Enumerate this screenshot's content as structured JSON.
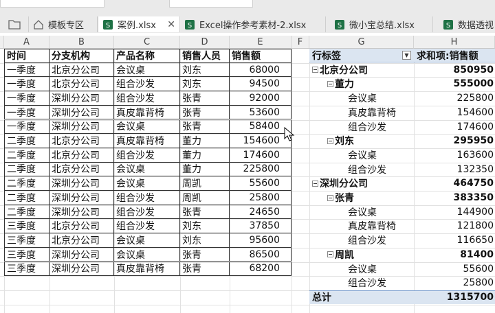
{
  "tabs": [
    {
      "label": "模板专区"
    },
    {
      "label": "案例.xlsx"
    },
    {
      "label": "Excel操作参考素材-2.xlsx"
    },
    {
      "label": "微小宝总结.xlsx"
    },
    {
      "label": "数据透视"
    }
  ],
  "columns": [
    "A",
    "B",
    "C",
    "D",
    "E",
    "F",
    "G",
    "H"
  ],
  "table": {
    "headers": [
      "时间",
      "分支机构",
      "产品名称",
      "销售人员",
      "销售额"
    ],
    "rows": [
      [
        "一季度",
        "北京分公司",
        "会议桌",
        "刘东",
        "68000"
      ],
      [
        "一季度",
        "北京分公司",
        "组合沙发",
        "刘东",
        "94500"
      ],
      [
        "一季度",
        "深圳分公司",
        "组合沙发",
        "张青",
        "92000"
      ],
      [
        "一季度",
        "深圳分公司",
        "真皮靠背椅",
        "张青",
        "53600"
      ],
      [
        "一季度",
        "深圳分公司",
        "会议桌",
        "张青",
        "58400"
      ],
      [
        "二季度",
        "北京分公司",
        "真皮靠背椅",
        "董力",
        "154600"
      ],
      [
        "二季度",
        "北京分公司",
        "组合沙发",
        "董力",
        "174600"
      ],
      [
        "二季度",
        "北京分公司",
        "会议桌",
        "董力",
        "225800"
      ],
      [
        "二季度",
        "深圳分公司",
        "会议桌",
        "周凯",
        "55600"
      ],
      [
        "二季度",
        "深圳分公司",
        "组合沙发",
        "周凯",
        "25800"
      ],
      [
        "二季度",
        "深圳分公司",
        "组合沙发",
        "张青",
        "24650"
      ],
      [
        "三季度",
        "北京分公司",
        "组合沙发",
        "刘东",
        "37850"
      ],
      [
        "三季度",
        "北京分公司",
        "会议桌",
        "刘东",
        "95600"
      ],
      [
        "三季度",
        "深圳分公司",
        "会议桌",
        "张青",
        "86500"
      ],
      [
        "三季度",
        "深圳分公司",
        "真皮靠背椅",
        "张青",
        "68200"
      ]
    ]
  },
  "pivot": {
    "row_label": "行标签",
    "value_label": "求和项:销售额",
    "rows": [
      {
        "label": "北京分公司",
        "value": "850950",
        "level": 0
      },
      {
        "label": "董力",
        "value": "555000",
        "level": 1
      },
      {
        "label": "会议桌",
        "value": "225800",
        "level": 2
      },
      {
        "label": "真皮靠背椅",
        "value": "154600",
        "level": 2
      },
      {
        "label": "组合沙发",
        "value": "174600",
        "level": 2
      },
      {
        "label": "刘东",
        "value": "295950",
        "level": 1
      },
      {
        "label": "会议桌",
        "value": "163600",
        "level": 2
      },
      {
        "label": "组合沙发",
        "value": "132350",
        "level": 2
      },
      {
        "label": "深圳分公司",
        "value": "464750",
        "level": 0
      },
      {
        "label": "张青",
        "value": "383350",
        "level": 1
      },
      {
        "label": "会议桌",
        "value": "144900",
        "level": 2
      },
      {
        "label": "真皮靠背椅",
        "value": "121800",
        "level": 2
      },
      {
        "label": "组合沙发",
        "value": "116650",
        "level": 2
      },
      {
        "label": "周凯",
        "value": "81400",
        "level": 1
      },
      {
        "label": "会议桌",
        "value": "55600",
        "level": 2
      },
      {
        "label": "组合沙发",
        "value": "25800",
        "level": 2
      }
    ],
    "total_label": "总计",
    "total_value": "1315700"
  },
  "colors": {
    "excel_green": "#1e7145",
    "pivot_header": "#dbe5f1",
    "pivot_total": "#dbe5f1"
  }
}
